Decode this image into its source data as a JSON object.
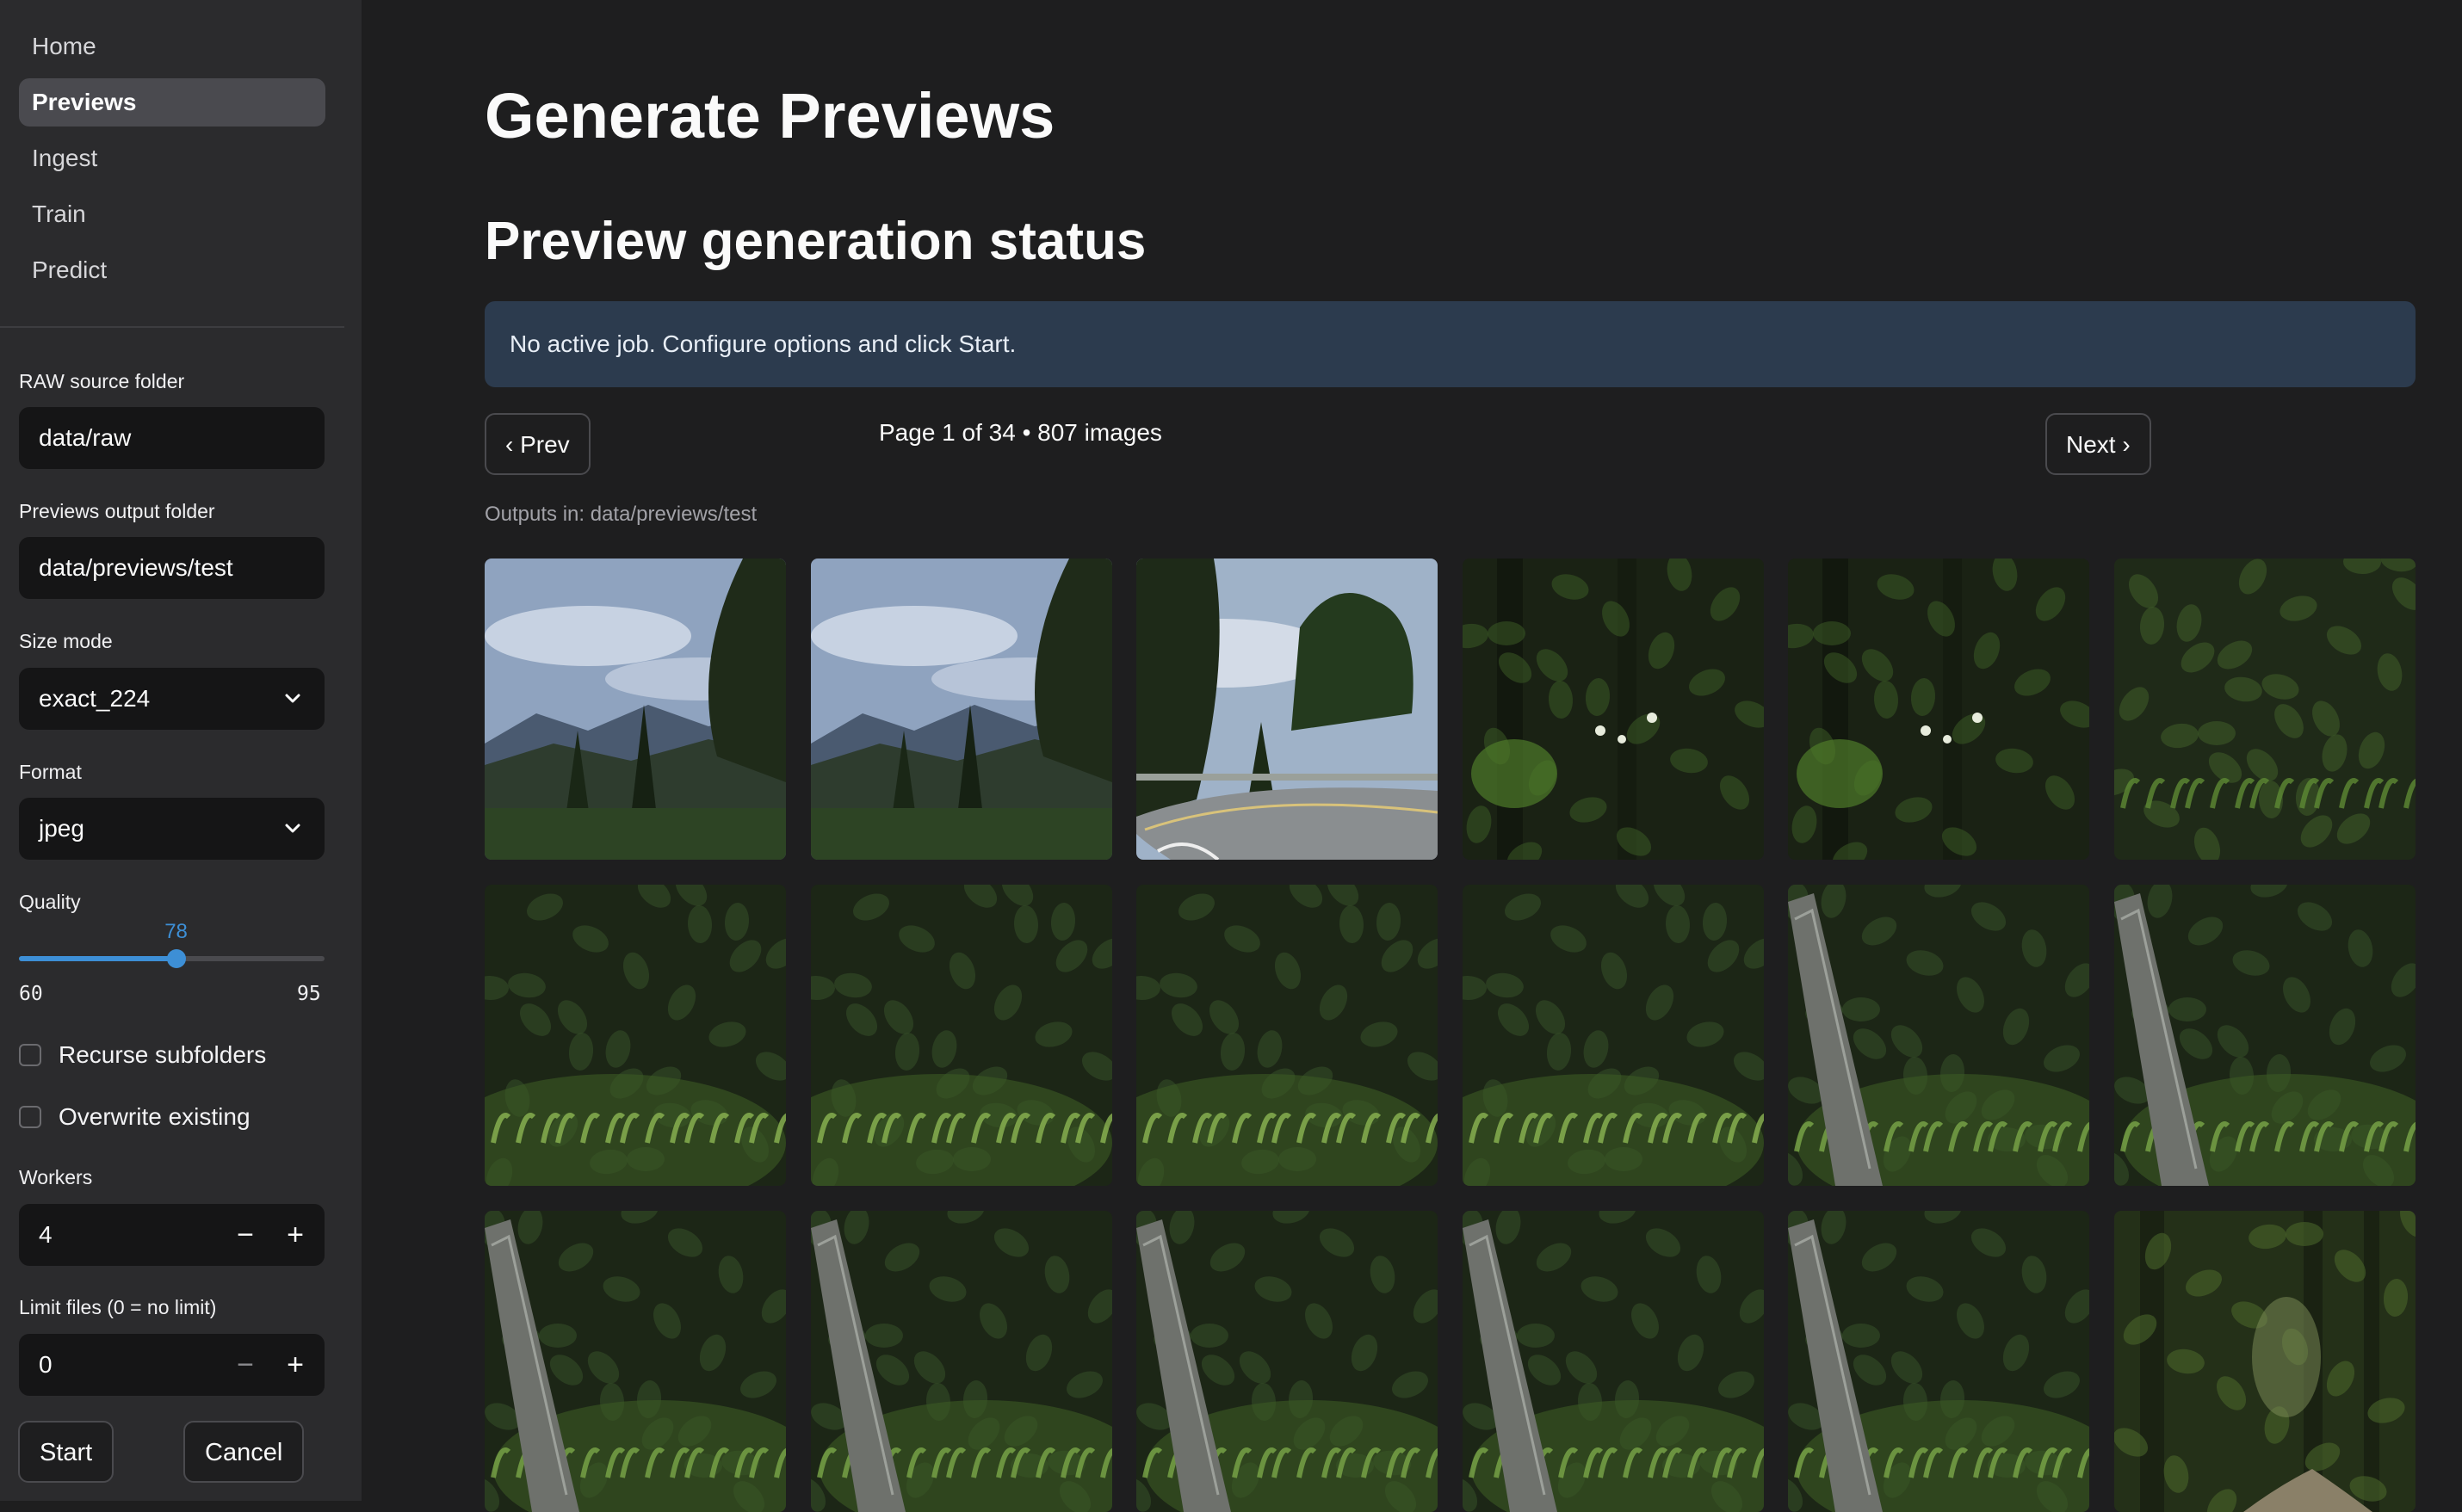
{
  "nav": {
    "items": [
      {
        "label": "Home",
        "active": false
      },
      {
        "label": "Previews",
        "active": true
      },
      {
        "label": "Ingest",
        "active": false
      },
      {
        "label": "Train",
        "active": false
      },
      {
        "label": "Predict",
        "active": false
      }
    ]
  },
  "sidebar": {
    "raw_source": {
      "label": "RAW source folder",
      "value": "data/raw"
    },
    "output_folder": {
      "label": "Previews output folder",
      "value": "data/previews/test"
    },
    "size_mode": {
      "label": "Size mode",
      "value": "exact_224"
    },
    "format": {
      "label": "Format",
      "value": "jpeg"
    },
    "quality": {
      "label": "Quality",
      "value": 78,
      "value_text": "78",
      "min": 60,
      "max": 95,
      "min_text": "60",
      "max_text": "95"
    },
    "recurse": {
      "label": "Recurse subfolders",
      "checked": false
    },
    "overwrite": {
      "label": "Overwrite existing",
      "checked": false
    },
    "workers": {
      "label": "Workers",
      "value": "4",
      "minus": "−",
      "plus": "+"
    },
    "limit": {
      "label": "Limit files (0 = no limit)",
      "value": "0",
      "minus": "−",
      "plus": "+"
    },
    "start_label": "Start",
    "cancel_label": "Cancel",
    "accent_color": "#3d8fd6"
  },
  "main": {
    "title": "Generate Previews",
    "subtitle": "Preview generation status",
    "info_message": "No active job. Configure options and click Start.",
    "prev_label": "‹ Prev",
    "next_label": "Next ›",
    "page_info": "Page 1 of 34 • 807 images",
    "outputs_text": "Outputs in: data/previews/test"
  },
  "thumbnails": [
    {
      "scene": "mountain-vista"
    },
    {
      "scene": "mountain-vista"
    },
    {
      "scene": "road-curve"
    },
    {
      "scene": "dark-forest-flowers"
    },
    {
      "scene": "dark-forest-flowers"
    },
    {
      "scene": "dense-foliage"
    },
    {
      "scene": "foliage-ferns"
    },
    {
      "scene": "foliage-ferns"
    },
    {
      "scene": "foliage-ferns"
    },
    {
      "scene": "foliage-ferns"
    },
    {
      "scene": "fence-foliage"
    },
    {
      "scene": "fence-foliage"
    },
    {
      "scene": "fence-foliage"
    },
    {
      "scene": "fence-foliage"
    },
    {
      "scene": "fence-foliage"
    },
    {
      "scene": "fence-foliage"
    },
    {
      "scene": "fence-foliage"
    },
    {
      "scene": "forest-path"
    }
  ]
}
